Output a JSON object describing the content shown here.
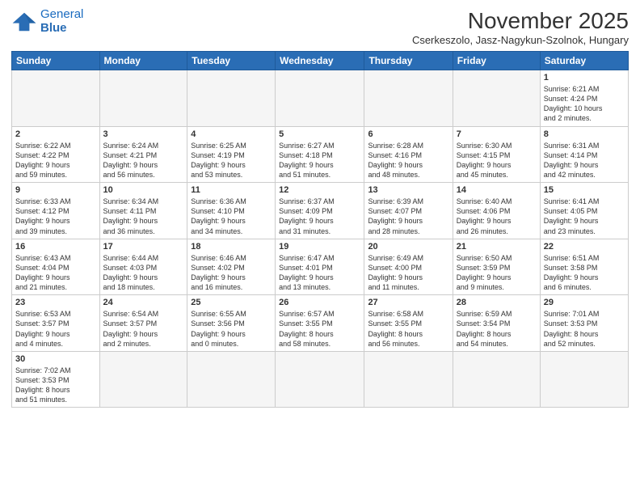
{
  "header": {
    "logo_general": "General",
    "logo_blue": "Blue",
    "title": "November 2025",
    "subtitle": "Cserkeszolo, Jasz-Nagykun-Szolnok, Hungary"
  },
  "columns": [
    "Sunday",
    "Monday",
    "Tuesday",
    "Wednesday",
    "Thursday",
    "Friday",
    "Saturday"
  ],
  "weeks": [
    [
      {
        "day": "",
        "info": ""
      },
      {
        "day": "",
        "info": ""
      },
      {
        "day": "",
        "info": ""
      },
      {
        "day": "",
        "info": ""
      },
      {
        "day": "",
        "info": ""
      },
      {
        "day": "",
        "info": ""
      },
      {
        "day": "1",
        "info": "Sunrise: 6:21 AM\nSunset: 4:24 PM\nDaylight: 10 hours\nand 2 minutes."
      }
    ],
    [
      {
        "day": "2",
        "info": "Sunrise: 6:22 AM\nSunset: 4:22 PM\nDaylight: 9 hours\nand 59 minutes."
      },
      {
        "day": "3",
        "info": "Sunrise: 6:24 AM\nSunset: 4:21 PM\nDaylight: 9 hours\nand 56 minutes."
      },
      {
        "day": "4",
        "info": "Sunrise: 6:25 AM\nSunset: 4:19 PM\nDaylight: 9 hours\nand 53 minutes."
      },
      {
        "day": "5",
        "info": "Sunrise: 6:27 AM\nSunset: 4:18 PM\nDaylight: 9 hours\nand 51 minutes."
      },
      {
        "day": "6",
        "info": "Sunrise: 6:28 AM\nSunset: 4:16 PM\nDaylight: 9 hours\nand 48 minutes."
      },
      {
        "day": "7",
        "info": "Sunrise: 6:30 AM\nSunset: 4:15 PM\nDaylight: 9 hours\nand 45 minutes."
      },
      {
        "day": "8",
        "info": "Sunrise: 6:31 AM\nSunset: 4:14 PM\nDaylight: 9 hours\nand 42 minutes."
      }
    ],
    [
      {
        "day": "9",
        "info": "Sunrise: 6:33 AM\nSunset: 4:12 PM\nDaylight: 9 hours\nand 39 minutes."
      },
      {
        "day": "10",
        "info": "Sunrise: 6:34 AM\nSunset: 4:11 PM\nDaylight: 9 hours\nand 36 minutes."
      },
      {
        "day": "11",
        "info": "Sunrise: 6:36 AM\nSunset: 4:10 PM\nDaylight: 9 hours\nand 34 minutes."
      },
      {
        "day": "12",
        "info": "Sunrise: 6:37 AM\nSunset: 4:09 PM\nDaylight: 9 hours\nand 31 minutes."
      },
      {
        "day": "13",
        "info": "Sunrise: 6:39 AM\nSunset: 4:07 PM\nDaylight: 9 hours\nand 28 minutes."
      },
      {
        "day": "14",
        "info": "Sunrise: 6:40 AM\nSunset: 4:06 PM\nDaylight: 9 hours\nand 26 minutes."
      },
      {
        "day": "15",
        "info": "Sunrise: 6:41 AM\nSunset: 4:05 PM\nDaylight: 9 hours\nand 23 minutes."
      }
    ],
    [
      {
        "day": "16",
        "info": "Sunrise: 6:43 AM\nSunset: 4:04 PM\nDaylight: 9 hours\nand 21 minutes."
      },
      {
        "day": "17",
        "info": "Sunrise: 6:44 AM\nSunset: 4:03 PM\nDaylight: 9 hours\nand 18 minutes."
      },
      {
        "day": "18",
        "info": "Sunrise: 6:46 AM\nSunset: 4:02 PM\nDaylight: 9 hours\nand 16 minutes."
      },
      {
        "day": "19",
        "info": "Sunrise: 6:47 AM\nSunset: 4:01 PM\nDaylight: 9 hours\nand 13 minutes."
      },
      {
        "day": "20",
        "info": "Sunrise: 6:49 AM\nSunset: 4:00 PM\nDaylight: 9 hours\nand 11 minutes."
      },
      {
        "day": "21",
        "info": "Sunrise: 6:50 AM\nSunset: 3:59 PM\nDaylight: 9 hours\nand 9 minutes."
      },
      {
        "day": "22",
        "info": "Sunrise: 6:51 AM\nSunset: 3:58 PM\nDaylight: 9 hours\nand 6 minutes."
      }
    ],
    [
      {
        "day": "23",
        "info": "Sunrise: 6:53 AM\nSunset: 3:57 PM\nDaylight: 9 hours\nand 4 minutes."
      },
      {
        "day": "24",
        "info": "Sunrise: 6:54 AM\nSunset: 3:57 PM\nDaylight: 9 hours\nand 2 minutes."
      },
      {
        "day": "25",
        "info": "Sunrise: 6:55 AM\nSunset: 3:56 PM\nDaylight: 9 hours\nand 0 minutes."
      },
      {
        "day": "26",
        "info": "Sunrise: 6:57 AM\nSunset: 3:55 PM\nDaylight: 8 hours\nand 58 minutes."
      },
      {
        "day": "27",
        "info": "Sunrise: 6:58 AM\nSunset: 3:55 PM\nDaylight: 8 hours\nand 56 minutes."
      },
      {
        "day": "28",
        "info": "Sunrise: 6:59 AM\nSunset: 3:54 PM\nDaylight: 8 hours\nand 54 minutes."
      },
      {
        "day": "29",
        "info": "Sunrise: 7:01 AM\nSunset: 3:53 PM\nDaylight: 8 hours\nand 52 minutes."
      }
    ],
    [
      {
        "day": "30",
        "info": "Sunrise: 7:02 AM\nSunset: 3:53 PM\nDaylight: 8 hours\nand 51 minutes."
      },
      {
        "day": "",
        "info": ""
      },
      {
        "day": "",
        "info": ""
      },
      {
        "day": "",
        "info": ""
      },
      {
        "day": "",
        "info": ""
      },
      {
        "day": "",
        "info": ""
      },
      {
        "day": "",
        "info": ""
      }
    ]
  ]
}
